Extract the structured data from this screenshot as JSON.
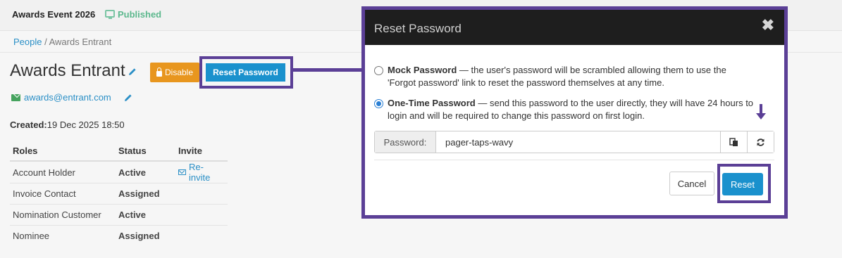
{
  "topbar": {
    "event_title": "Awards Event 2026",
    "status": "Published"
  },
  "breadcrumb": {
    "parent": "People",
    "separator": " / ",
    "current": "Awards Entrant"
  },
  "profile": {
    "name": "Awards Entrant",
    "disable_label": "Disable",
    "reset_password_label": "Reset Password",
    "email": "awards@entrant.com",
    "created_label": "Created:",
    "created_value": "19 Dec 2025 18:50"
  },
  "roles_table": {
    "headers": [
      "Roles",
      "Status",
      "Invite"
    ],
    "rows": [
      {
        "role": "Account Holder",
        "status": "Active",
        "invite": "Re-invite"
      },
      {
        "role": "Invoice Contact",
        "status": "Assigned",
        "invite": ""
      },
      {
        "role": "Nomination Customer",
        "status": "Active",
        "invite": ""
      },
      {
        "role": "Nominee",
        "status": "Assigned",
        "invite": ""
      }
    ]
  },
  "modal": {
    "title": "Reset Password",
    "close_glyph": "✖",
    "option_mock": {
      "label": "Mock Password",
      "line1": " — the user's password will be scrambled allowing them to use the",
      "line2": "'Forgot password' link to reset the password themselves at any time.",
      "selected": false
    },
    "option_otp": {
      "label": "One-Time Password",
      "line1": " — send this password to the user directly, they will have 24 hours to",
      "line2": "login and will be required to change this password on first login.",
      "selected": true
    },
    "password_label": "Password:",
    "password_value": "pager-taps-wavy",
    "cancel_label": "Cancel",
    "reset_label": "Reset"
  },
  "colors": {
    "highlight": "#5b3f96",
    "primary": "#1a91cd",
    "warning": "#e8961e",
    "active": "#4caf50",
    "published": "#5cb88d"
  }
}
